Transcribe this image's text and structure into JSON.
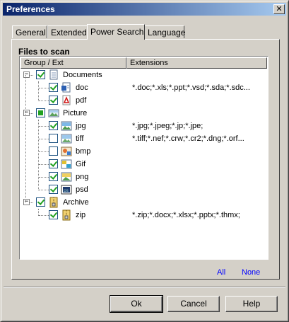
{
  "window": {
    "title": "Preferences",
    "close_glyph": "✕"
  },
  "tabs": [
    {
      "label": "General"
    },
    {
      "label": "Extended"
    },
    {
      "label": "Power Search"
    },
    {
      "label": "Language"
    }
  ],
  "active_tab": "Power Search",
  "section": {
    "title": "Files to scan"
  },
  "columns": {
    "group": "Group / Ext",
    "extensions": "Extensions"
  },
  "tree": [
    {
      "type": "group",
      "label": "Documents",
      "icon": "document-icon",
      "state": "checked"
    },
    {
      "type": "item",
      "label": "doc",
      "icon": "word-doc-icon",
      "state": "checked",
      "ext": "*.doc;*.xls;*.ppt;*.vsd;*.sda;*.sdc..."
    },
    {
      "type": "item",
      "label": "pdf",
      "icon": "pdf-icon",
      "state": "checked",
      "ext": ""
    },
    {
      "type": "group",
      "label": "Picture",
      "icon": "picture-icon",
      "state": "partial"
    },
    {
      "type": "item",
      "label": "jpg",
      "icon": "jpg-image-icon",
      "state": "checked",
      "ext": "*.jpg;*.jpeg;*.jp;*.jpe;"
    },
    {
      "type": "item",
      "label": "tiff",
      "icon": "tiff-image-icon",
      "state": "unchecked",
      "ext": "*.tiff;*.nef;*.crw;*.cr2;*.dng;*.orf..."
    },
    {
      "type": "item",
      "label": "bmp",
      "icon": "bmp-image-icon",
      "state": "unchecked",
      "ext": ""
    },
    {
      "type": "item",
      "label": "Gif",
      "icon": "gif-image-icon",
      "state": "checked",
      "ext": ""
    },
    {
      "type": "item",
      "label": "png",
      "icon": "png-image-icon",
      "state": "checked",
      "ext": ""
    },
    {
      "type": "item",
      "label": "psd",
      "icon": "psd-image-icon",
      "state": "checked",
      "ext": ""
    },
    {
      "type": "group",
      "label": "Archive",
      "icon": "archive-icon",
      "state": "checked"
    },
    {
      "type": "item",
      "label": "zip",
      "icon": "zip-icon",
      "state": "checked",
      "ext": "*.zip;*.docx;*.xlsx;*.pptx;*.thmx;"
    }
  ],
  "links": {
    "all": "All",
    "none": "None"
  },
  "buttons": {
    "ok": "Ok",
    "cancel": "Cancel",
    "help": "Help"
  },
  "colors": {
    "title_bar": "#0a246a",
    "check": "#21a121",
    "link": "#0000ff"
  }
}
